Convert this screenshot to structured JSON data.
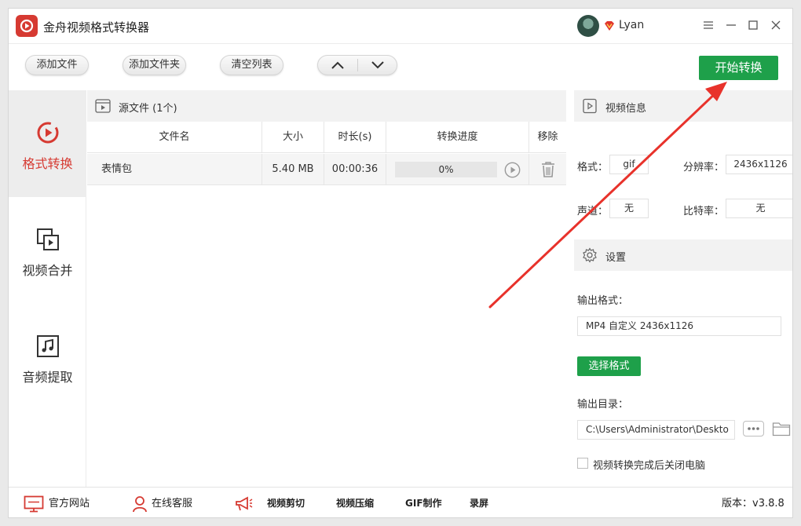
{
  "app": {
    "title": "金舟视频格式转换器",
    "username": "Lyan"
  },
  "toolbar": {
    "add_file": "添加文件",
    "add_folder": "添加文件夹",
    "clear_list": "清空列表",
    "start_convert": "开始转换"
  },
  "nav": {
    "items": [
      {
        "label": "格式转换",
        "icon": "convert-icon",
        "active": true
      },
      {
        "label": "视频合并",
        "icon": "merge-icon",
        "active": false
      },
      {
        "label": "音频提取",
        "icon": "music-icon",
        "active": false
      }
    ]
  },
  "file_panel": {
    "source_label": "源文件 (1个)",
    "columns": [
      "文件名",
      "大小",
      "时长(s)",
      "转换进度",
      "移除"
    ],
    "rows": [
      {
        "name": "表情包",
        "size": "5.40 MB",
        "duration": "00:00:36",
        "progress_text": "0%",
        "progress": 0
      }
    ]
  },
  "video_info": {
    "title": "视频信息",
    "format_label": "格式：",
    "format_value": "gif",
    "resolution_label": "分辨率：",
    "resolution_value": "2436x1126",
    "channel_label": "声道：",
    "channel_value": "无",
    "bitrate_label": "比特率：",
    "bitrate_value": "无"
  },
  "settings": {
    "title": "设置",
    "output_format_label": "输出格式：",
    "output_format_value": "MP4 自定义 2436x1126",
    "choose_format": "选择格式",
    "output_dir_label": "输出目录：",
    "output_dir_value": "C:\\Users\\Administrator\\Deskto",
    "shutdown_label": "视频转换完成后关闭电脑"
  },
  "footer": {
    "official_site": "官方网站",
    "online_service": "在线客服",
    "video_cut": "视频剪切",
    "video_compress": "视频压缩",
    "gif_make": "GIF制作",
    "screen_record": "录屏",
    "version": "版本：v3.8.8"
  },
  "colors": {
    "brand_red": "#d63a32",
    "accent_green": "#1ea04a",
    "annotation_red": "#e8322b"
  }
}
